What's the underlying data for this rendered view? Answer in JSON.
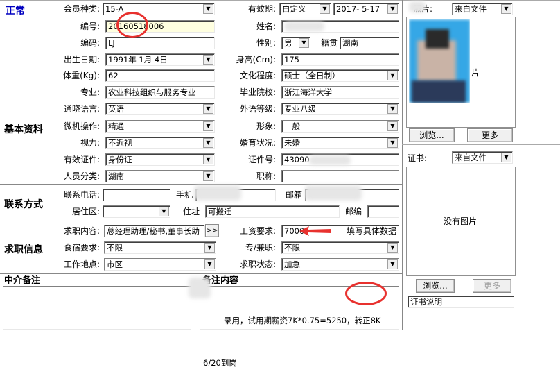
{
  "status": "正常",
  "sections": {
    "basic": "基本资料",
    "contact": "联系方式",
    "job": "求职信息"
  },
  "labels": {
    "member_type": "会员种类:",
    "validity": "有效期:",
    "photo": "照片:",
    "number": "编号:",
    "name": "姓名:",
    "code": "编码:",
    "gender": "性别:",
    "hometown": "籍贯",
    "birth_date": "出生日期:",
    "height": "身高(Cm):",
    "weight": "体重(Kg):",
    "education": "文化程度:",
    "major": "专业:",
    "school": "毕业院校:",
    "language": "通晓语言:",
    "foreign_level": "外语等级:",
    "computer": "微机操作:",
    "appearance": "形象:",
    "vision": "视力:",
    "marital": "婚育状况:",
    "id_type": "有效证件:",
    "id_no": "证件号:",
    "category": "人员分类:",
    "title": "职称:",
    "phone": "联系电话:",
    "mobile": "手机",
    "email": "邮箱",
    "district": "居住区:",
    "address": "住址",
    "postcode": "邮编",
    "job_content": "求职内容:",
    "salary": "工资要求:",
    "food": "食宿要求:",
    "fulltime": "专/兼职:",
    "workplace": "工作地点:",
    "job_status": "求职状态:",
    "cert": "证书:",
    "agency_note": "中介备注",
    "remarks": "备注内容"
  },
  "values": {
    "member_type": "15-A",
    "validity_type": "自定义",
    "validity_date": "2017- 5-17",
    "photo_source": "来自文件",
    "number": "20160518006",
    "name": "",
    "code": "LJ",
    "gender": "男",
    "hometown": "湖南",
    "birth_date": "1991年 1月 4日",
    "height": "175",
    "weight": "62",
    "education": "硕士（全日制）",
    "major": "农业科技组织与服务专业",
    "school": "浙江海洋大学",
    "language": "英语",
    "foreign_level": "专业八级",
    "computer": "精通",
    "appearance": "一般",
    "vision": "不近视",
    "marital": "未婚",
    "id_type": "身份证",
    "id_no": "43090",
    "category": "湖南",
    "title": "",
    "phone": "",
    "mobile": "",
    "email": "",
    "district": "",
    "address": "可搬迁",
    "postcode": "",
    "job_content": "总经理助理/秘书,董事长助",
    "job_more_btn": ">>",
    "salary": "7000",
    "salary_hint": "填写具体数据",
    "food": "不限",
    "fulltime": "不限",
    "workplace": "市区",
    "job_status": "加急",
    "cert_source": "来自文件",
    "no_image": "没有图片",
    "cert_desc": "证书说明",
    "photo_text": "片",
    "remarks_line1": "录用，试用期薪资7K*0.75=5250，转正8K",
    "remarks_line2": "6/20到岗"
  },
  "buttons": {
    "photo_browse": "浏览...",
    "photo_more": "更多",
    "cert_browse": "浏览...",
    "cert_more": "更多"
  },
  "icons": {
    "dropdown": "▼",
    "arrow": "red-arrow-icon",
    "circle": "red-circle-annotation"
  },
  "colors": {
    "status": "#0000c0",
    "annotation": "#e8312e"
  }
}
